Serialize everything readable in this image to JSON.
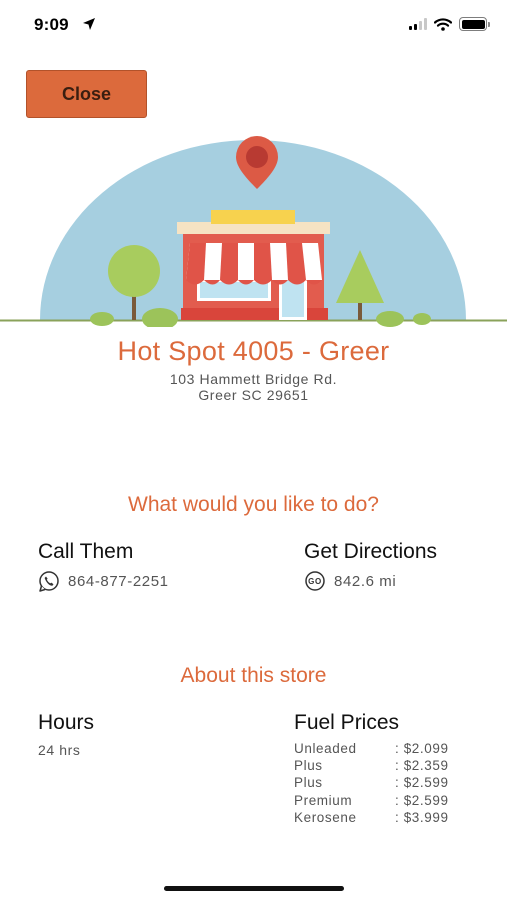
{
  "status_bar": {
    "time": "9:09"
  },
  "close_label": "Close",
  "store": {
    "name": "Hot Spot 4005 - Greer",
    "address_line1": "103 Hammett Bridge Rd.",
    "address_line2": "Greer  SC  29651"
  },
  "actions": {
    "heading": "What would you like to do?",
    "call": {
      "title": "Call Them",
      "phone": "864-877-2251",
      "icon": "phone-icon"
    },
    "directions": {
      "title": "Get Directions",
      "distance": "842.6 mi",
      "icon": "go-icon"
    }
  },
  "about": {
    "heading": "About this store",
    "hours_title": "Hours",
    "hours_value": "24 hrs",
    "fuel_title": "Fuel Prices",
    "fuel_prices": [
      {
        "name": "Unleaded",
        "price": ": $2.099"
      },
      {
        "name": "Plus",
        "price": ": $2.359"
      },
      {
        "name": "Plus",
        "price": ": $2.599"
      },
      {
        "name": "Premium",
        "price": ": $2.599"
      },
      {
        "name": "Kerosene",
        "price": ": $3.999"
      }
    ]
  },
  "colors": {
    "accent": "#dc6a3c",
    "sky": "#a6cfe0",
    "awning_red": "#e05448",
    "tree_green": "#9cc35a"
  }
}
